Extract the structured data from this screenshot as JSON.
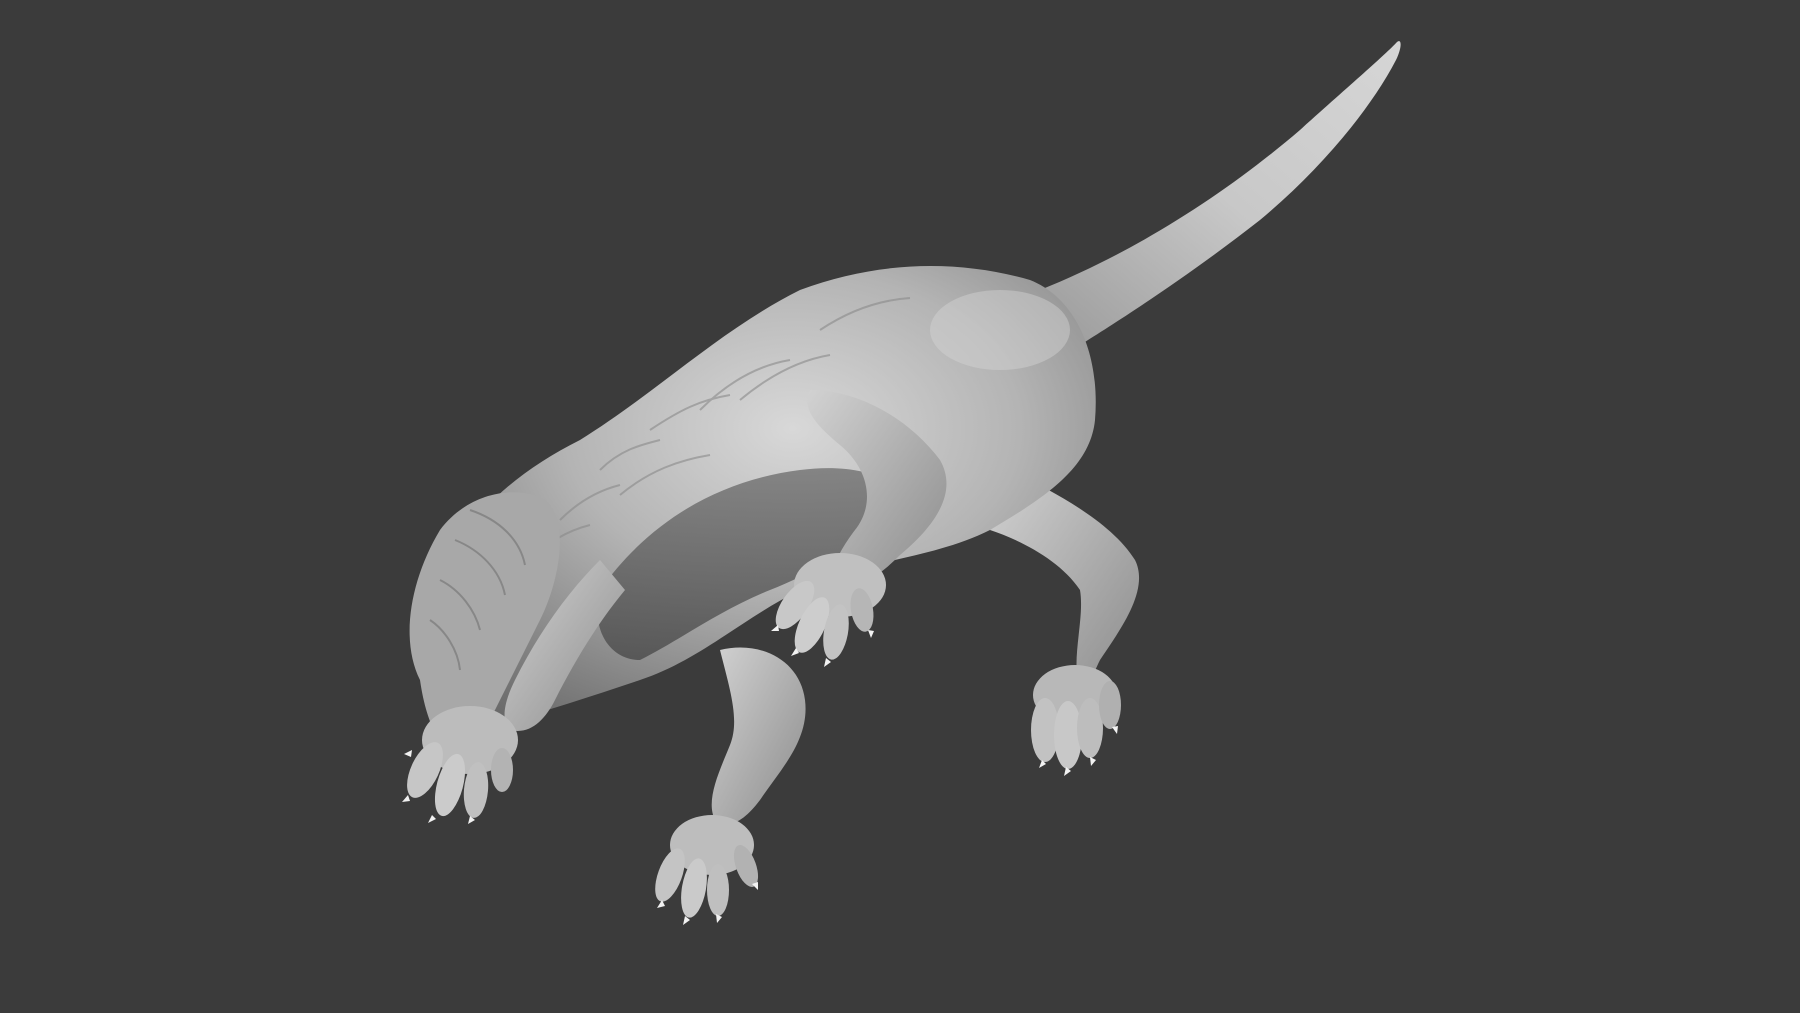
{
  "scene": {
    "background_color": "#3b3b3b",
    "subject": "sculpted-creature-model",
    "material_color": "#bdbdbd",
    "shadow_color": "#6e6e6e",
    "highlight_color": "#e6e6e6"
  }
}
